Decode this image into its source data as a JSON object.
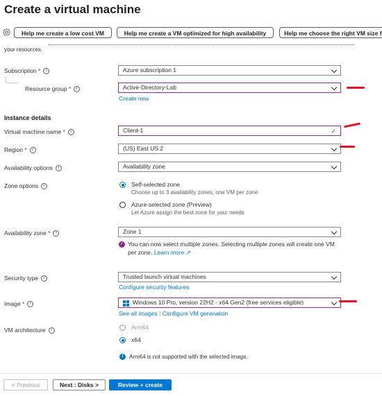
{
  "page": {
    "title": "Create a virtual machine",
    "more": "···"
  },
  "copilot": {
    "prompts": [
      "Help me create a low cost VM",
      "Help me create a VM optimized for high availability",
      "Help me choose the right VM size fo"
    ]
  },
  "intro_tail": "your resources.",
  "project": {
    "subscription": {
      "label": "Subscription",
      "value": "Azure subscription 1"
    },
    "resource_group": {
      "label": "Resource group",
      "value": "Active-Directory-Lab",
      "create_link": "Create new"
    }
  },
  "instance": {
    "heading": "Instance details",
    "vm_name": {
      "label": "Virtual machine name",
      "value": "Client-1"
    },
    "region": {
      "label": "Region",
      "value": "(US) East US 2"
    },
    "availability_options": {
      "label": "Availability options",
      "value": "Availability zone"
    },
    "zone_options": {
      "label": "Zone options",
      "options": [
        {
          "title": "Self-selected zone",
          "desc": "Choose up to 3 availability zones, one VM per zone",
          "selected": true
        },
        {
          "title": "Azure-selected zone (Preview)",
          "desc": "Let Azure assign the best zone for your needs",
          "selected": false
        }
      ]
    },
    "availability_zone": {
      "label": "Availability zone",
      "value": "Zone 1",
      "note_line1": "You can now select multiple zones. Selecting multiple zones will create one VM",
      "note_line2": "per zone.",
      "learn_more": "Learn more"
    },
    "security_type": {
      "label": "Security type",
      "value": "Trusted launch virtual machines",
      "link": "Configure security features"
    },
    "image": {
      "label": "Image",
      "value": "Windows 10 Pro, version 22H2 - x64 Gen2 (free services eligible)",
      "see_all": "See all images",
      "separator": "|",
      "configure": "Configure VM generation"
    },
    "vm_architecture": {
      "label": "VM architecture",
      "options": [
        {
          "title": "Arm64",
          "selected": false,
          "disabled": true
        },
        {
          "title": "x64",
          "selected": true,
          "disabled": false
        }
      ],
      "note": "Arm64 is not supported with the selected image."
    }
  },
  "footer": {
    "previous": "< Previous",
    "next": "Next : Disks >",
    "review": "Review + create"
  },
  "colors": {
    "accent": "#0078d4",
    "required": "#a4262c",
    "annotation": "#e81123",
    "focus": "#8a2d8e"
  }
}
